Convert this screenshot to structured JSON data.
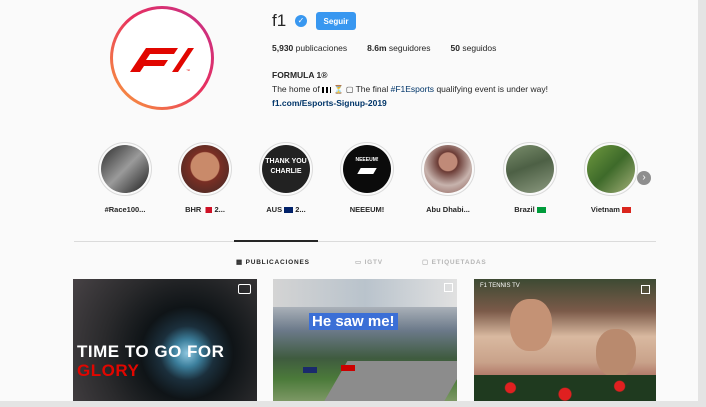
{
  "profile": {
    "username": "f1",
    "follow_label": "Seguir",
    "stats": {
      "posts_count": "5,930",
      "posts_label": "publicaciones",
      "followers_count": "8.6m",
      "followers_label": "seguidores",
      "following_count": "50",
      "following_label": "seguidos"
    },
    "name": "FORMULA 1®",
    "bio_prefix": "The home of",
    "bio_middle": "The final",
    "bio_hashtag": "#F1Esports",
    "bio_suffix": "qualifying event is under way!",
    "link": "f1.com/Esports-Signup-2019"
  },
  "highlights": [
    {
      "label": "#Race100...",
      "color": "#1c1c1c"
    },
    {
      "label": "BHR",
      "suffix": "2...",
      "color": "#6a3326"
    },
    {
      "label": "AUS",
      "suffix": "2...",
      "color": "#262626"
    },
    {
      "label": "NEEEUM!",
      "color": "#0e0e0e"
    },
    {
      "label": "Abu Dhabi...",
      "color": "#8a5a54"
    },
    {
      "label": "Brazil",
      "color": "#58704e"
    },
    {
      "label": "Vietnam",
      "color": "#5e8a3e"
    }
  ],
  "highlight_texts": {
    "aus_line1": "THANK YOU",
    "aus_line2": "CHARLIE",
    "neeeum_line": "NEEEUM!"
  },
  "tabs": [
    {
      "label": "PUBLICACIONES",
      "active": true
    },
    {
      "label": "IGTV",
      "active": false
    },
    {
      "label": "ETIQUETADAS",
      "active": false
    }
  ],
  "posts": {
    "p1_line1": "TIME TO GO FOR",
    "p1_line2": "GLORY",
    "p2_caption": "He saw me!",
    "p3_label": "F1 TENNIS TV"
  },
  "colors": {
    "accent": "#3897f0",
    "f1_red": "#e10600",
    "link": "#003569"
  }
}
